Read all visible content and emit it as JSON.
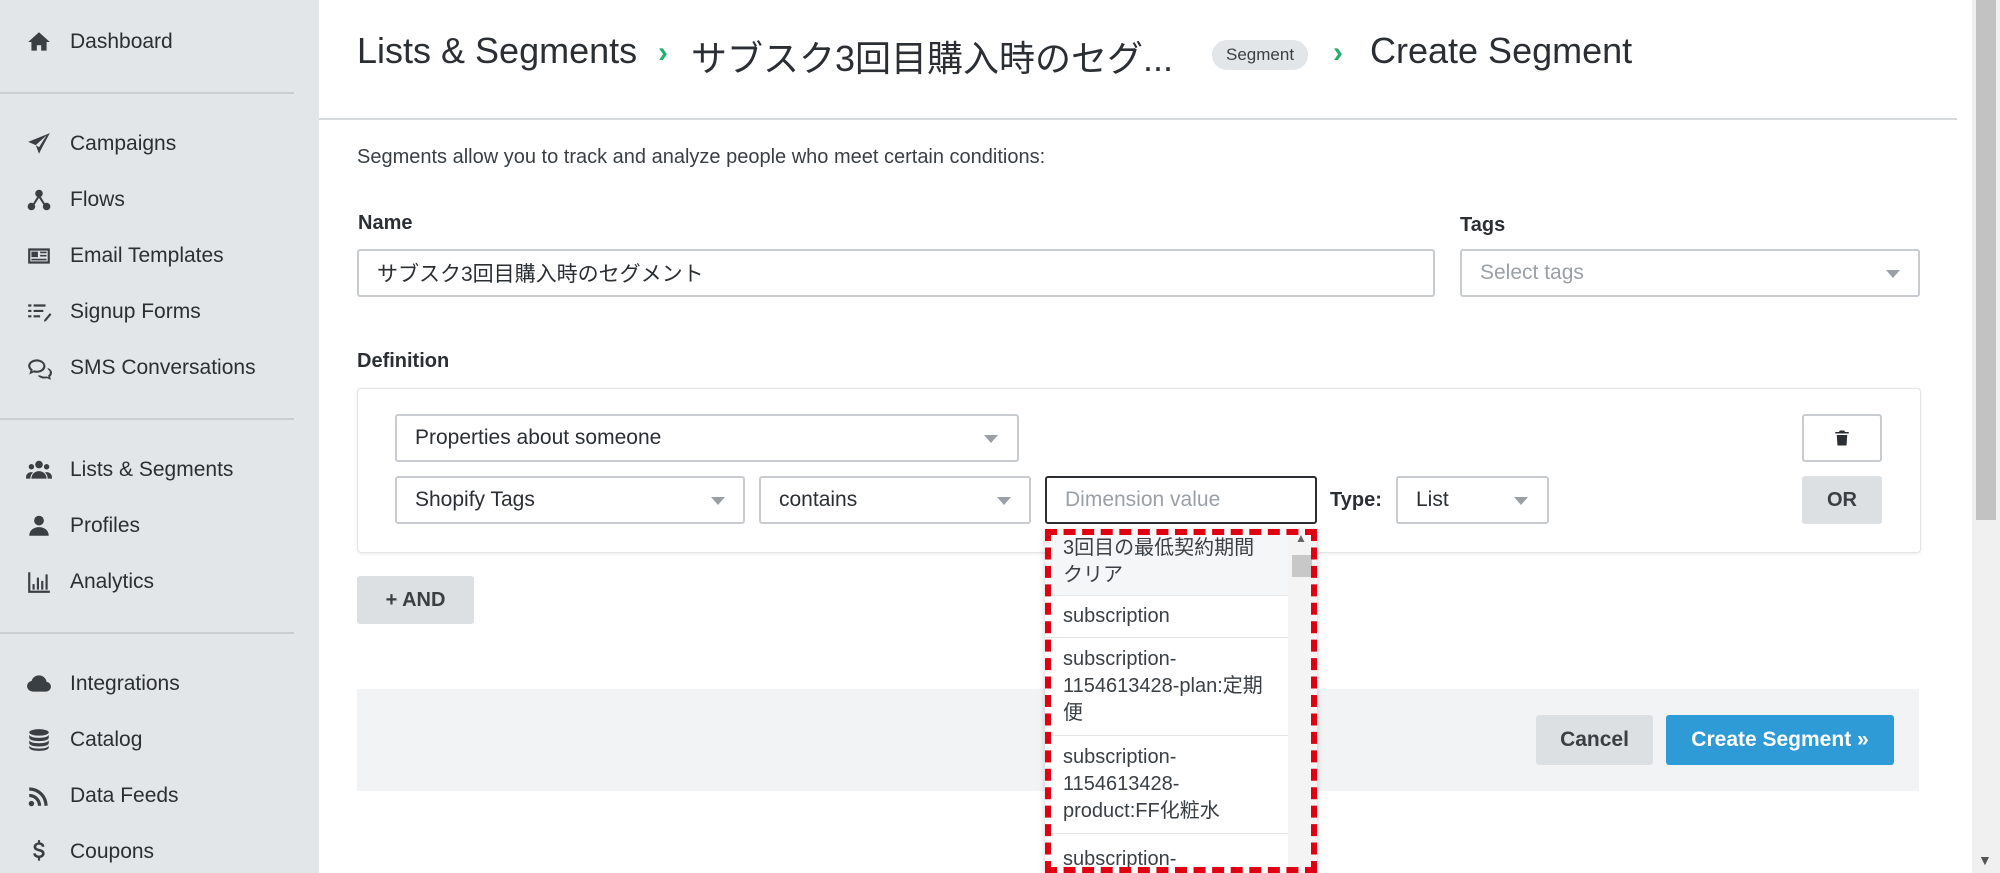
{
  "sidebar": {
    "items": [
      {
        "label": "Dashboard",
        "icon": "home-icon"
      },
      {
        "label": "Campaigns",
        "icon": "paper-plane-icon"
      },
      {
        "label": "Flows",
        "icon": "flow-icon"
      },
      {
        "label": "Email Templates",
        "icon": "newspaper-icon"
      },
      {
        "label": "Signup Forms",
        "icon": "list-pen-icon"
      },
      {
        "label": "SMS Conversations",
        "icon": "chat-bubbles-icon"
      },
      {
        "label": "Lists & Segments",
        "icon": "users-icon"
      },
      {
        "label": "Profiles",
        "icon": "user-icon"
      },
      {
        "label": "Analytics",
        "icon": "bar-chart-icon"
      },
      {
        "label": "Integrations",
        "icon": "cloud-icon"
      },
      {
        "label": "Catalog",
        "icon": "database-icon"
      },
      {
        "label": "Data Feeds",
        "icon": "rss-icon"
      },
      {
        "label": "Coupons",
        "icon": "dollar-icon"
      }
    ]
  },
  "header": {
    "crumb1": "Lists & Segments",
    "crumb2": "サブスク3回目購入時のセグ...",
    "badge": "Segment",
    "crumb3": "Create Segment",
    "separator": "›"
  },
  "form": {
    "intro": "Segments allow you to track and analyze people who meet certain conditions:",
    "name_label": "Name",
    "name_value": "サブスク3回目購入時のセグメント",
    "tags_label": "Tags",
    "tags_placeholder": "Select tags",
    "definition_label": "Definition",
    "condition_type": "Properties about someone",
    "property": "Shopify Tags",
    "operator": "contains",
    "value_placeholder": "Dimension value",
    "type_label": "Type:",
    "type_value": "List",
    "or_label": "OR",
    "and_label": "+ AND",
    "cancel_label": "Cancel",
    "create_label": "Create Segment »"
  },
  "dropdown": {
    "options": [
      "3回目の最低契約期間クリア",
      "subscription",
      "subscription-1154613428-plan:定期便",
      "subscription-1154613428-product:FF化粧水",
      "subscription-"
    ]
  },
  "colors": {
    "accent": "#2e9bd6",
    "chevron": "#23b06b",
    "highlight": "#e10012"
  }
}
